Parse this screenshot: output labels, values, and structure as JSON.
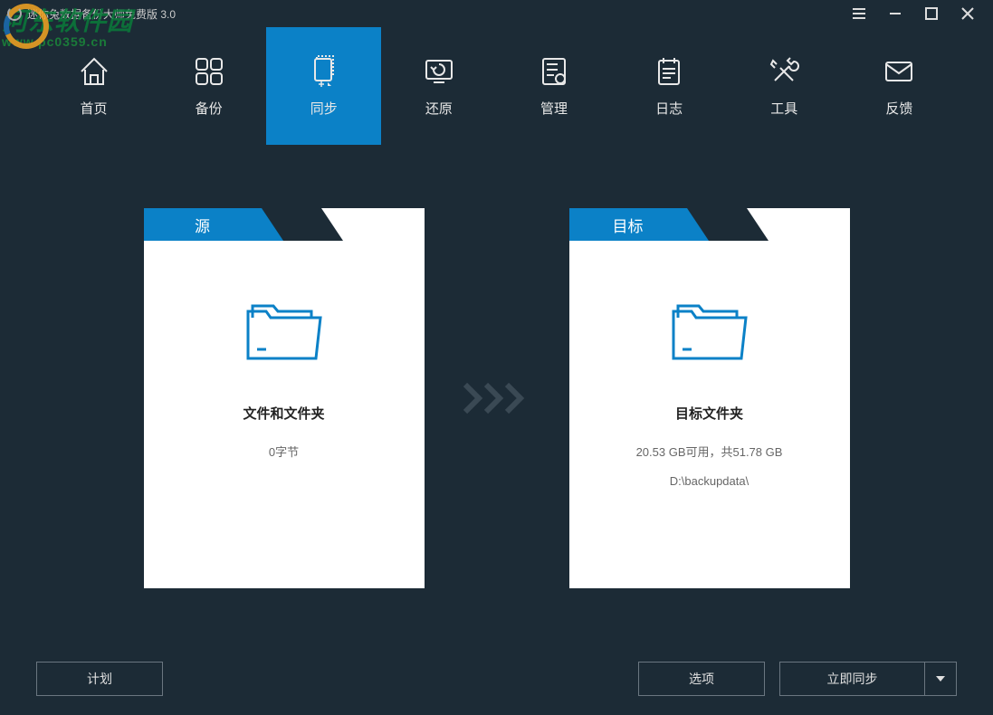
{
  "titlebar": {
    "title": "迷你兔数据备份大师免费版 3.0"
  },
  "watermark": {
    "line1": "河东软件园",
    "line2": "www.pc0359.cn"
  },
  "nav": {
    "items": [
      {
        "label": "首页"
      },
      {
        "label": "备份"
      },
      {
        "label": "同步"
      },
      {
        "label": "还原"
      },
      {
        "label": "管理"
      },
      {
        "label": "日志"
      },
      {
        "label": "工具"
      },
      {
        "label": "反馈"
      }
    ],
    "active_index": 2
  },
  "source_card": {
    "tab": "源",
    "title": "文件和文件夹",
    "size": "0字节"
  },
  "target_card": {
    "tab": "目标",
    "title": "目标文件夹",
    "space": "20.53 GB可用，共51.78 GB",
    "path": "D:\\backupdata\\"
  },
  "footer": {
    "plan": "计划",
    "options": "选项",
    "sync_now": "立即同步"
  }
}
